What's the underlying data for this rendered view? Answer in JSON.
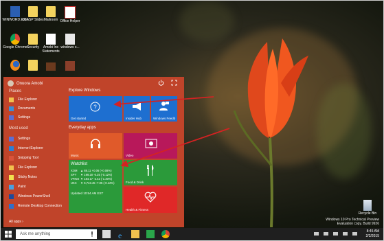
{
  "desktop": {
    "icons": [
      {
        "label": "WINWORD.EXE",
        "icon": "document-icon"
      },
      {
        "label": "CLASP Slides",
        "icon": "folder-icon"
      },
      {
        "label": "Mailroom",
        "icon": "folder-icon"
      },
      {
        "label": "Office Helper",
        "icon": "office-icon"
      },
      {
        "label": "Google Chrome",
        "icon": "chrome-icon"
      },
      {
        "label": "Security",
        "icon": "folder-icon"
      },
      {
        "label": "Amobi Inc Statements",
        "icon": "document-icon"
      },
      {
        "label": "windows s...",
        "icon": "screen-icon"
      },
      {
        "label": "Firefox",
        "icon": "firefox-icon"
      },
      {
        "label": "",
        "icon": "folder-icon"
      },
      {
        "label": "",
        "icon": "briefcase-icon"
      },
      {
        "label": "",
        "icon": "tool-icon"
      }
    ],
    "recycle_bin": "Recycle Bin",
    "watermark": [
      "Windows 10 Pro Technical Preview",
      "Evaluation copy. Build 9926"
    ]
  },
  "start_menu": {
    "user_name": "Onuora Amobi",
    "places_header": "Places",
    "places": [
      "File Explorer",
      "Documents",
      "Settings"
    ],
    "most_used_header": "Most used",
    "most_used": [
      "Settings",
      "Internet Explorer",
      "Snipping Tool",
      "File Explorer",
      "Sticky Notes",
      "Paint",
      "Windows PowerShell",
      "Remote Desktop Connection"
    ],
    "all_apps": "All apps",
    "explore_header": "Explore Windows",
    "everyday_header": "Everyday apps",
    "tiles": {
      "get_started": "Get started",
      "insider_hub": "Insider Hub",
      "feedback": "Windows Feedb",
      "music": "Music",
      "video": "Video",
      "food": "Food & Drink",
      "health": "Health & Fitness"
    },
    "watchlist": {
      "title": "Watchlist",
      "rows": [
        {
          "sym": "XOM",
          "val": "▲ 88.11 +0.06 (+0.08%)"
        },
        {
          "sym": "SPY",
          "val": "▼ 199.20 -0.25 (-0.12%)"
        },
        {
          "sym": "VFINX",
          "val": "▼ 184.17 -2.42 (-1.30%)"
        },
        {
          "sym": "UKX",
          "val": "▼ 6,743.45 -7.05 (-0.12%)"
        }
      ],
      "updated": "Updated  10:54 AM EST"
    }
  },
  "taskbar": {
    "search_placeholder": "Ask me anything",
    "time": "8:45 AM",
    "date": "2/2/2015"
  },
  "colors": {
    "start_bg": "#c0442a",
    "tile_blue": "#1e6fd0",
    "tile_green": "#2b9a3a",
    "tile_magenta": "#b8185a",
    "tile_orange": "#e05a2a",
    "tile_red": "#e02828",
    "annotation_arrow": "#d42222"
  }
}
